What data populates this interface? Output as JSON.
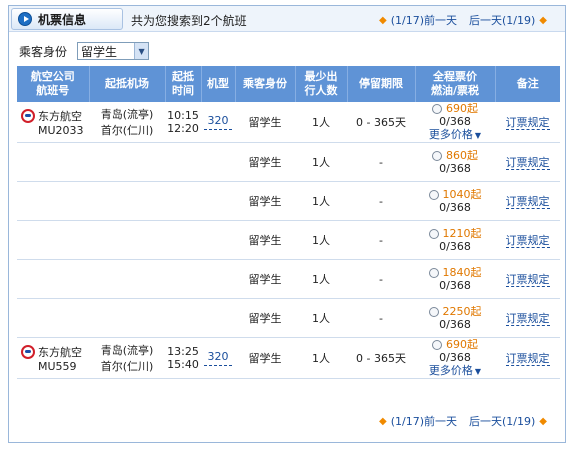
{
  "header": {
    "tab_label": "机票信息",
    "found_text": "共为您搜索到2个航班",
    "prev_label": "(1/17)前一天",
    "next_label": "后一天(1/19)"
  },
  "filter": {
    "label": "乘客身份",
    "selected": "留学生"
  },
  "table": {
    "headers": [
      "航空公司\n航班号",
      "起抵机场",
      "起抵\n时间",
      "机型",
      "乘客身份",
      "最少出\n行人数",
      "停留期限",
      "全程票价\n燃油/票税",
      "备注"
    ],
    "rows": [
      {
        "airline": "东方航空",
        "flight": "MU2033",
        "dep_airport": "青岛(流亭)",
        "arr_airport": "首尔(仁川)",
        "dep_time": "10:15",
        "arr_time": "12:20",
        "plane": "320",
        "identity": "留学生",
        "min_pax": "1人",
        "stay": "0 - 365天",
        "price": "690",
        "price_suffix": "起",
        "tax": "0/368",
        "more": "更多价格",
        "note": "订票规定"
      },
      {
        "identity": "留学生",
        "min_pax": "1人",
        "stay": "-",
        "price": "860",
        "price_suffix": "起",
        "tax": "0/368",
        "note": "订票规定"
      },
      {
        "identity": "留学生",
        "min_pax": "1人",
        "stay": "-",
        "price": "1040",
        "price_suffix": "起",
        "tax": "0/368",
        "note": "订票规定"
      },
      {
        "identity": "留学生",
        "min_pax": "1人",
        "stay": "-",
        "price": "1210",
        "price_suffix": "起",
        "tax": "0/368",
        "note": "订票规定"
      },
      {
        "identity": "留学生",
        "min_pax": "1人",
        "stay": "-",
        "price": "1840",
        "price_suffix": "起",
        "tax": "0/368",
        "note": "订票规定"
      },
      {
        "identity": "留学生",
        "min_pax": "1人",
        "stay": "-",
        "price": "2250",
        "price_suffix": "起",
        "tax": "0/368",
        "note": "订票规定"
      },
      {
        "airline": "东方航空",
        "flight": "MU559",
        "dep_airport": "青岛(流亭)",
        "arr_airport": "首尔(仁川)",
        "dep_time": "13:25",
        "arr_time": "15:40",
        "plane": "320",
        "identity": "留学生",
        "min_pax": "1人",
        "stay": "0 - 365天",
        "price": "690",
        "price_suffix": "起",
        "tax": "0/368",
        "more": "更多价格",
        "note": "订票规定"
      }
    ]
  },
  "colors": {
    "header_bg": "#5f93d6",
    "price": "#e07800",
    "link": "#1a4e9c",
    "airline_logo": "#d11f2a"
  }
}
